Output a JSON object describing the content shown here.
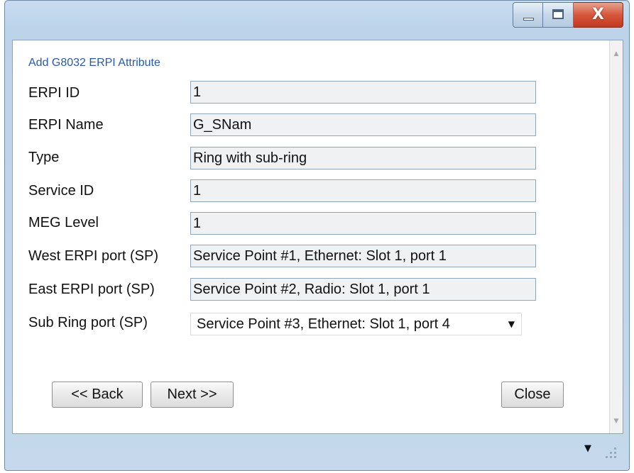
{
  "window": {
    "controls": {
      "minimize": "minimize",
      "maximize": "maximize",
      "close": "X"
    }
  },
  "form": {
    "title": "Add G8032 ERPI Attribute",
    "fields": [
      {
        "label": "ERPI ID",
        "value": "1"
      },
      {
        "label": "ERPI Name",
        "value": "G_SNam"
      },
      {
        "label": "Type",
        "value": "Ring with sub-ring"
      },
      {
        "label": "Service ID",
        "value": "1"
      },
      {
        "label": "MEG Level",
        "value": "1"
      },
      {
        "label": "West ERPI port (SP)",
        "value": "Service Point #1, Ethernet: Slot 1, port 1"
      },
      {
        "label": "East ERPI port (SP)",
        "value": "Service Point #2, Radio: Slot 1, port 1"
      }
    ],
    "sub_ring": {
      "label": "Sub Ring port (SP)",
      "selected": "Service Point #3, Ethernet: Slot 1, port 4",
      "arrow_icon": "chevron-down-icon"
    }
  },
  "buttons": {
    "back": "<< Back",
    "next": "Next >>",
    "close": "Close"
  },
  "scrollbar": {
    "up_icon": "chevron-up-icon",
    "down_icon": "chevron-down-icon"
  },
  "statusbar": {
    "dropdown_icon": "chevron-down-icon",
    "grip_icon": "resize-grip-icon"
  },
  "colors": {
    "title_link": "#2b58a8",
    "field_bg": "#eff1f3",
    "close_red": "#d6563c",
    "frame": "#c5d8ec"
  }
}
